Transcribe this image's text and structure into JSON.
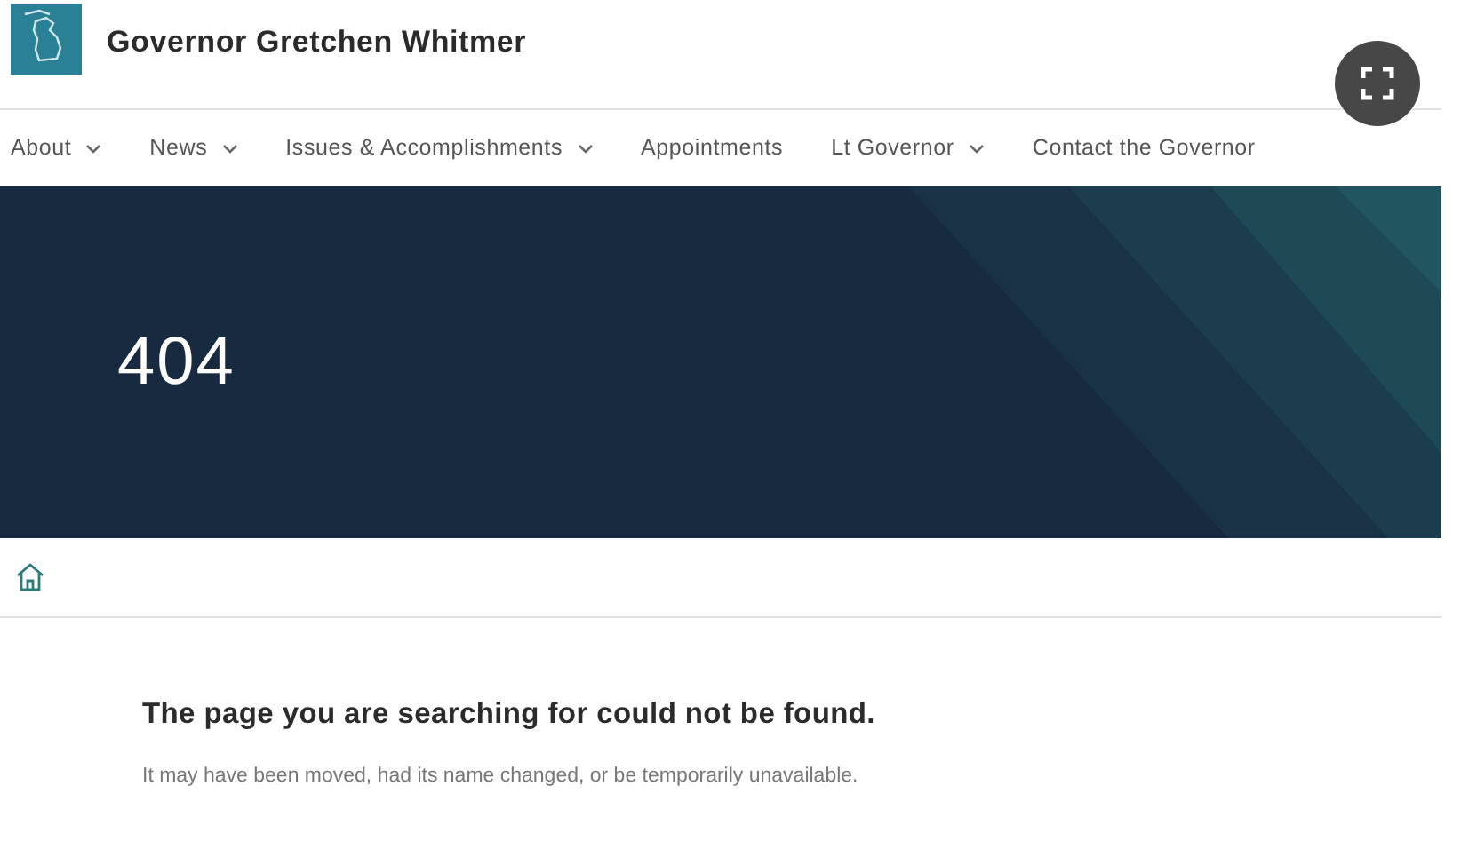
{
  "header": {
    "site_title": "Governor Gretchen Whitmer"
  },
  "nav": {
    "items": [
      {
        "label": "About",
        "kind": "dropdown"
      },
      {
        "label": "News",
        "kind": "dropdown"
      },
      {
        "label": "Issues & Accomplishments",
        "kind": "dropdown"
      },
      {
        "label": "Appointments",
        "kind": "link"
      },
      {
        "label": "Lt Governor",
        "kind": "dropdown"
      },
      {
        "label": "Contact the Governor",
        "kind": "link"
      }
    ]
  },
  "hero": {
    "title": "404"
  },
  "message": {
    "heading": "The page you are searching for could not be found.",
    "body": "It may have been moved, had its name changed, or be temporarily unavailable."
  }
}
